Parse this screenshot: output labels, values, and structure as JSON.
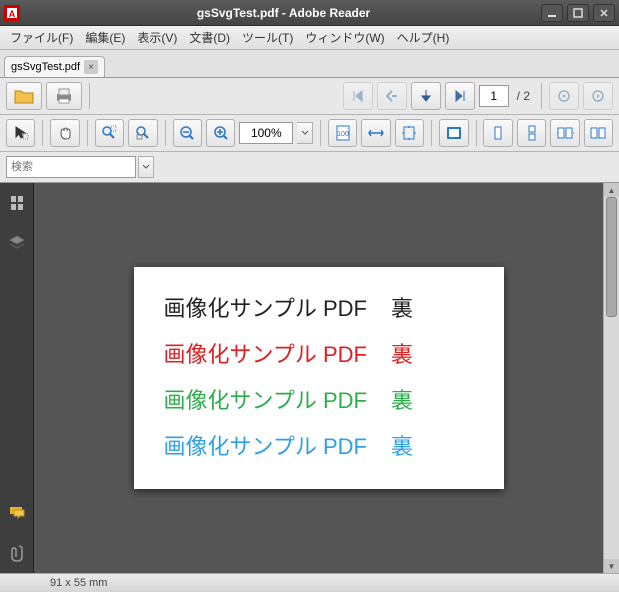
{
  "window": {
    "title": "gsSvgTest.pdf - Adobe Reader"
  },
  "menu": {
    "file": "ファイル(F)",
    "edit": "編集(E)",
    "view": "表示(V)",
    "document": "文書(D)",
    "tool": "ツール(T)",
    "windowm": "ウィンドウ(W)",
    "help": "ヘルプ(H)"
  },
  "tab": {
    "name": "gsSvgTest.pdf"
  },
  "nav": {
    "current": "1",
    "total": "/ 2"
  },
  "zoom": {
    "value": "100%"
  },
  "search": {
    "placeholder": "検索"
  },
  "doc": {
    "text_main": "画像化サンプル PDF",
    "text_side": "裏"
  },
  "status": {
    "size": "91 x 55 mm"
  }
}
